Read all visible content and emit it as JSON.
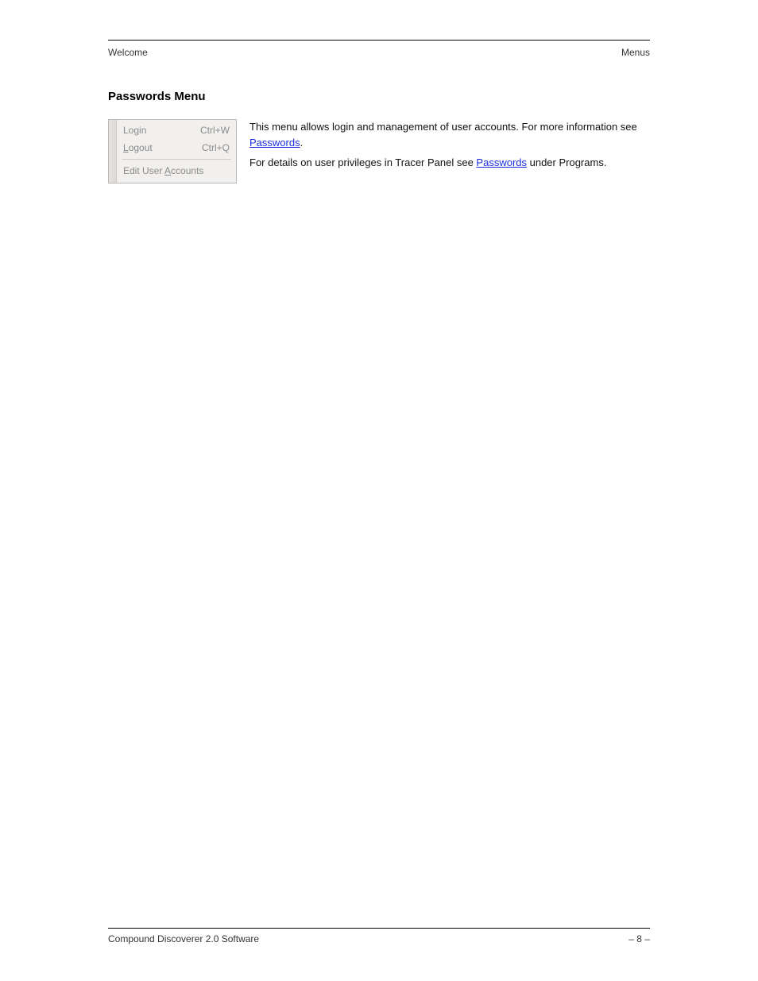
{
  "header": {
    "left": "Welcome",
    "right": "Menus"
  },
  "section": {
    "title": "Passwords Menu"
  },
  "menu": {
    "items": [
      {
        "label_pre": "Lo",
        "label_ul": "g",
        "label_post": "in",
        "shortcut": "Ctrl+W"
      },
      {
        "label_pre": "",
        "label_ul": "L",
        "label_post": "ogout",
        "shortcut": "Ctrl+Q"
      }
    ],
    "divider_item": {
      "label_pre": "Edit User ",
      "label_ul": "A",
      "label_post": "ccounts",
      "shortcut": ""
    }
  },
  "desc": {
    "p1_a": "This menu allows login and management of user accounts. For more information see ",
    "p1_link": "Passwords",
    "p1_b": ".",
    "p2_a": "For details on user privileges in Tracer Panel see ",
    "p2_link": "Passwords",
    "p2_b": " under Programs."
  },
  "footer": {
    "left": "Compound Discoverer 2.0 Software",
    "right": "– 8 –"
  }
}
